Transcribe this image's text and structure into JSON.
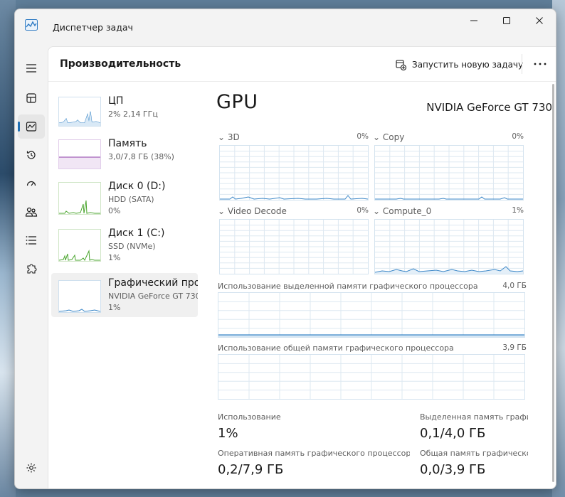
{
  "window": {
    "title": "Диспетчер задач"
  },
  "header": {
    "title": "Производительность",
    "run_task_label": "Запустить новую задачу"
  },
  "nav": {
    "items": [
      {
        "name": "menu",
        "icon": "hamburger-icon"
      },
      {
        "name": "processes",
        "icon": "processes-icon"
      },
      {
        "name": "performance",
        "icon": "performance-icon",
        "active": true
      },
      {
        "name": "app-history",
        "icon": "history-icon"
      },
      {
        "name": "startup",
        "icon": "speedometer-icon"
      },
      {
        "name": "users",
        "icon": "users-icon"
      },
      {
        "name": "details",
        "icon": "list-icon"
      },
      {
        "name": "services",
        "icon": "puzzle-icon"
      },
      {
        "name": "settings",
        "icon": "gear-icon"
      }
    ]
  },
  "resources": [
    {
      "name": "ЦП",
      "line1": "2% 2,14 ГГц",
      "line2": "",
      "color": "#3a86c7"
    },
    {
      "name": "Память",
      "line1": "3,0/7,8 ГБ (38%)",
      "line2": "",
      "color": "#8e3fa8"
    },
    {
      "name": "Диск 0 (D:)",
      "line1": "HDD (SATA)",
      "line2": "0%",
      "color": "#4aa52e"
    },
    {
      "name": "Диск 1 (C:)",
      "line1": "SSD (NVMe)",
      "line2": "1%",
      "color": "#4aa52e"
    },
    {
      "name": "Графический про",
      "line1": "NVIDIA GeForce GT 730",
      "line2": "1%",
      "color": "#3a86c7",
      "selected": true
    }
  ],
  "gpu": {
    "title": "GPU",
    "model": "NVIDIA GeForce GT 730",
    "engines": [
      {
        "label": "3D",
        "percent": "0%"
      },
      {
        "label": "Copy",
        "percent": "0%"
      },
      {
        "label": "Video Decode",
        "percent": "0%"
      },
      {
        "label": "Compute_0",
        "percent": "1%"
      }
    ],
    "dedicated_memory": {
      "label": "Использование выделенной памяти графического процессора",
      "value": "4,0 ГБ"
    },
    "shared_memory": {
      "label": "Использование общей памяти графического процессора",
      "value": "3,9 ГБ"
    },
    "stats": {
      "usage_label": "Использование",
      "usage_value": "1%",
      "dedicated_label": "Выделенная память графич",
      "dedicated_value": "0,1/4,0 ГБ",
      "gpu_ram_label": "Оперативная память графического процессора",
      "gpu_ram_value": "0,2/7,9 ГБ",
      "shared_label": "Общая память графическо",
      "shared_value": "0,0/3,9 ГБ"
    }
  },
  "colors": {
    "accent": "#1f6fb3",
    "graph_line": "#3a86c7",
    "graph_grid": "#d4e3ef"
  }
}
